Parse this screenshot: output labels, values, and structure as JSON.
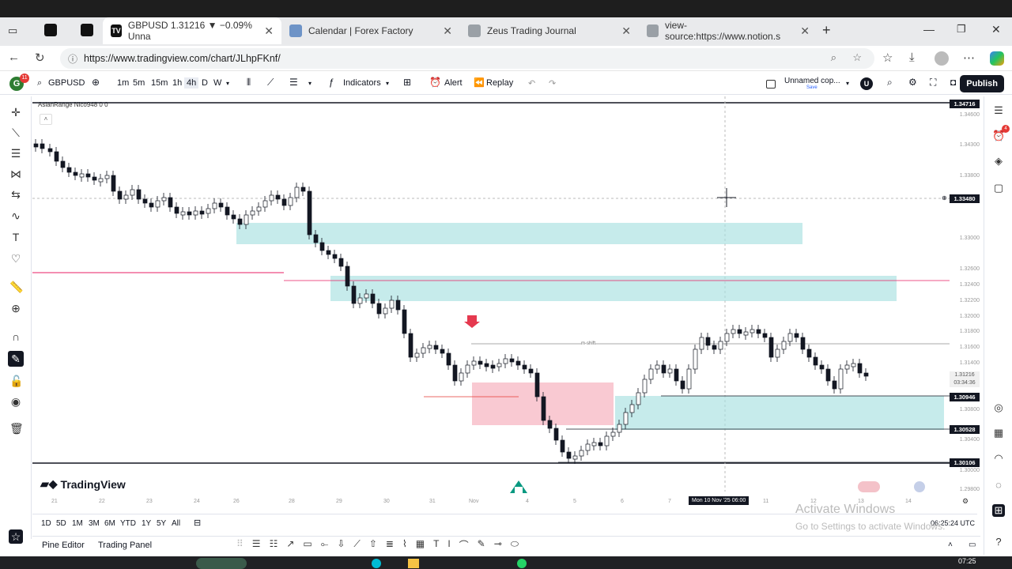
{
  "browser": {
    "tabs": [
      {
        "title": "GBPUSD 1.31216 ▼ −0.09% Unna",
        "active": true,
        "icon": "tradingview-icon"
      },
      {
        "title": "Calendar | Forex Factory",
        "active": false,
        "icon": "forexfactory-icon"
      },
      {
        "title": "Zeus Trading Journal",
        "active": false,
        "icon": "notion-icon"
      },
      {
        "title": "view-source:https://www.notion.s",
        "active": false,
        "icon": "notion-icon"
      }
    ],
    "url": "https://www.tradingview.com/chart/JLhpFKnf/"
  },
  "toolbar": {
    "symbol": "GBPUSD",
    "notif_count": "11",
    "intervals": [
      "1m",
      "5m",
      "15m",
      "1h",
      "4h",
      "D",
      "W"
    ],
    "active_interval": "4h",
    "indicators": "Indicators",
    "alert": "Alert",
    "replay": "Replay",
    "layout_name": "Unnamed cop...",
    "layout_save": "Save",
    "avatar": "U",
    "publish": "Publish"
  },
  "chart": {
    "indicator_label": "AsianRange Nico948",
    "indicator_values": "0  0",
    "annotation": "m-shift",
    "logo": "TradingView",
    "price_labels": [
      "1.34716",
      "1.33480",
      "1.30946",
      "1.30528",
      "1.30106"
    ],
    "last_price": "1.31216",
    "countdown": "03:34:36",
    "price_ticks": [
      "1.34600",
      "1.34300",
      "1.33800",
      "1.33000",
      "1.32600",
      "1.32400",
      "1.32200",
      "1.32000",
      "1.31800",
      "1.31600",
      "1.31400",
      "1.31200",
      "1.30800",
      "1.30400",
      "1.30000",
      "1.29800"
    ],
    "time_ticks": [
      "21",
      "22",
      "23",
      "24",
      "26",
      "28",
      "29",
      "30",
      "31",
      "Nov",
      "4",
      "5",
      "6",
      "7",
      "10",
      "11",
      "12",
      "13",
      "14",
      "16"
    ],
    "crosshair_time": "Mon 10 Nov '25  06:00"
  },
  "bottom": {
    "ranges": [
      "1D",
      "5D",
      "1M",
      "3M",
      "6M",
      "YTD",
      "1Y",
      "5Y",
      "All"
    ],
    "clock": "06:25:24 UTC"
  },
  "footer": {
    "pine_editor": "Pine Editor",
    "trading_panel": "Trading Panel"
  },
  "watermark": {
    "line1": "Activate Windows",
    "line2": "Go to Settings to activate Windows."
  },
  "taskbar": {
    "time": "07:25"
  },
  "colors": {
    "zone_teal": "#a8e0e0",
    "zone_pink": "#f7b7c3",
    "down_arrow": "#e5394f",
    "up_arrow": "#089981",
    "candle": "#131722"
  }
}
